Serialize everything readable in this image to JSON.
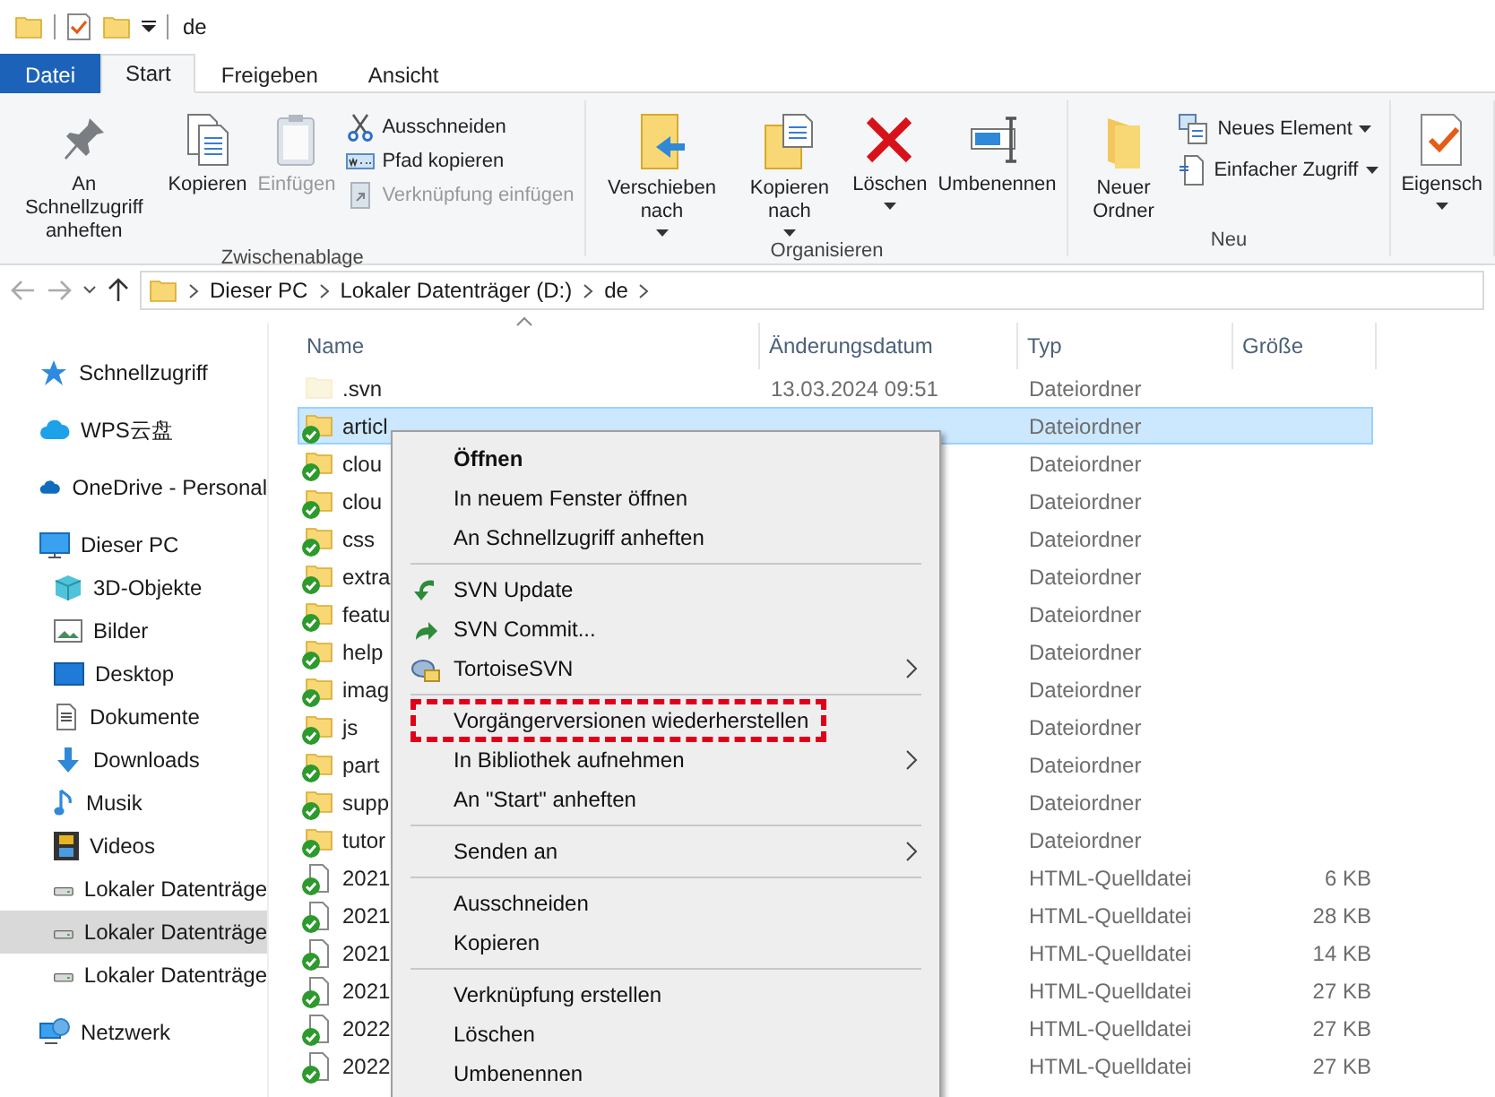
{
  "title_bar": {
    "title": "de"
  },
  "ribbon_tabs": [
    {
      "label": "Datei",
      "kind": "file",
      "selected": false
    },
    {
      "label": "Start",
      "kind": "tab",
      "selected": true
    },
    {
      "label": "Freigeben",
      "kind": "tab",
      "selected": false
    },
    {
      "label": "Ansicht",
      "kind": "tab",
      "selected": false
    }
  ],
  "ribbon_groups": [
    {
      "label": "Zwischenablage",
      "large": [
        {
          "label": "An Schnellzugriff anheften",
          "disabled": false,
          "dropdown": false
        },
        {
          "label": "Kopieren",
          "disabled": false,
          "dropdown": false
        },
        {
          "label": "Einfügen",
          "disabled": true,
          "dropdown": false
        }
      ],
      "small": [
        {
          "label": "Ausschneiden",
          "disabled": false,
          "dropdown": false
        },
        {
          "label": "Pfad kopieren",
          "disabled": false,
          "dropdown": false
        },
        {
          "label": "Verknüpfung einfügen",
          "disabled": true,
          "dropdown": false
        }
      ]
    },
    {
      "label": "Organisieren",
      "large": [
        {
          "label": "Verschieben nach",
          "disabled": false,
          "dropdown": true
        },
        {
          "label": "Kopieren nach",
          "disabled": false,
          "dropdown": true
        },
        {
          "label": "Löschen",
          "disabled": false,
          "dropdown": true
        },
        {
          "label": "Umbenennen",
          "disabled": false,
          "dropdown": false
        }
      ]
    },
    {
      "label": "Neu",
      "large": [
        {
          "label": "Neuer Ordner",
          "disabled": false,
          "dropdown": false
        }
      ],
      "small": [
        {
          "label": "Neues Element",
          "disabled": false,
          "dropdown": true
        },
        {
          "label": "Einfacher Zugriff",
          "disabled": false,
          "dropdown": true
        }
      ]
    },
    {
      "large": [
        {
          "label": "Eigensch",
          "disabled": false,
          "dropdown": true
        }
      ]
    }
  ],
  "breadcrumb": [
    "Dieser PC",
    "Lokaler Datenträger (D:)",
    "de"
  ],
  "sidebar": {
    "items": [
      {
        "label": "Schnellzugriff",
        "selected": false
      },
      {
        "label": "WPS云盘",
        "selected": false
      },
      {
        "label": "OneDrive - Personal",
        "selected": false
      },
      {
        "label": "Dieser PC",
        "selected": false,
        "children": [
          {
            "label": "3D-Objekte",
            "selected": false
          },
          {
            "label": "Bilder",
            "selected": false
          },
          {
            "label": "Desktop",
            "selected": false
          },
          {
            "label": "Dokumente",
            "selected": false
          },
          {
            "label": "Downloads",
            "selected": false
          },
          {
            "label": "Musik",
            "selected": false
          },
          {
            "label": "Videos",
            "selected": false
          },
          {
            "label": "Lokaler Datenträge",
            "selected": false
          },
          {
            "label": "Lokaler Datenträge",
            "selected": true
          },
          {
            "label": "Lokaler Datenträge",
            "selected": false
          }
        ]
      },
      {
        "label": "Netzwerk",
        "selected": false
      }
    ]
  },
  "file_list": {
    "columns": [
      "Name",
      "Änderungsdatum",
      "Typ",
      "Größe"
    ],
    "rows": [
      {
        "kind": "folder",
        "name": ".svn",
        "date": "13.03.2024 09:51",
        "type": "Dateiordner",
        "size": "",
        "hidden": true,
        "versioned": false,
        "selected": false
      },
      {
        "kind": "folder",
        "name": "articl",
        "date": "",
        "type": "Dateiordner",
        "size": "",
        "hidden": false,
        "versioned": true,
        "selected": true
      },
      {
        "kind": "folder",
        "name": "clou",
        "date": "",
        "type": "Dateiordner",
        "size": "",
        "hidden": false,
        "versioned": true,
        "selected": false
      },
      {
        "kind": "folder",
        "name": "clou",
        "date": "",
        "type": "Dateiordner",
        "size": "",
        "hidden": false,
        "versioned": true,
        "selected": false
      },
      {
        "kind": "folder",
        "name": "css",
        "date": "",
        "type": "Dateiordner",
        "size": "",
        "hidden": false,
        "versioned": true,
        "selected": false
      },
      {
        "kind": "folder",
        "name": "extra",
        "date": "",
        "type": "Dateiordner",
        "size": "",
        "hidden": false,
        "versioned": true,
        "selected": false
      },
      {
        "kind": "folder",
        "name": "featu",
        "date": "",
        "type": "Dateiordner",
        "size": "",
        "hidden": false,
        "versioned": true,
        "selected": false
      },
      {
        "kind": "folder",
        "name": "help",
        "date": "",
        "type": "Dateiordner",
        "size": "",
        "hidden": false,
        "versioned": true,
        "selected": false
      },
      {
        "kind": "folder",
        "name": "imag",
        "date": "",
        "type": "Dateiordner",
        "size": "",
        "hidden": false,
        "versioned": true,
        "selected": false
      },
      {
        "kind": "folder",
        "name": "js",
        "date": "",
        "type": "Dateiordner",
        "size": "",
        "hidden": false,
        "versioned": true,
        "selected": false
      },
      {
        "kind": "folder",
        "name": "part",
        "date": "",
        "type": "Dateiordner",
        "size": "",
        "hidden": false,
        "versioned": true,
        "selected": false
      },
      {
        "kind": "folder",
        "name": "supp",
        "date": "",
        "type": "Dateiordner",
        "size": "",
        "hidden": false,
        "versioned": true,
        "selected": false
      },
      {
        "kind": "folder",
        "name": "tutor",
        "date": "",
        "type": "Dateiordner",
        "size": "",
        "hidden": false,
        "versioned": true,
        "selected": false
      },
      {
        "kind": "file",
        "name": "2021",
        "date": "",
        "type": "HTML-Quelldatei",
        "size": "6 KB",
        "hidden": false,
        "versioned": true,
        "selected": false
      },
      {
        "kind": "file",
        "name": "2021",
        "date": "",
        "type": "HTML-Quelldatei",
        "size": "28 KB",
        "hidden": false,
        "versioned": true,
        "selected": false
      },
      {
        "kind": "file",
        "name": "2021",
        "date": "",
        "type": "HTML-Quelldatei",
        "size": "14 KB",
        "hidden": false,
        "versioned": true,
        "selected": false
      },
      {
        "kind": "file",
        "name": "2021",
        "date": "",
        "type": "HTML-Quelldatei",
        "size": "27 KB",
        "hidden": false,
        "versioned": true,
        "selected": false
      },
      {
        "kind": "file",
        "name": "2022",
        "date": "",
        "type": "HTML-Quelldatei",
        "size": "27 KB",
        "hidden": false,
        "versioned": true,
        "selected": false
      },
      {
        "kind": "file",
        "name": "2022",
        "date": "",
        "type": "HTML-Quelldatei",
        "size": "27 KB",
        "hidden": false,
        "versioned": true,
        "selected": false
      }
    ]
  },
  "context_menu": {
    "items": [
      {
        "kind": "item",
        "label": "Öffnen",
        "bold": true,
        "submenu": false,
        "marked": false
      },
      {
        "kind": "item",
        "label": "In neuem Fenster öffnen",
        "bold": false,
        "submenu": false,
        "marked": false
      },
      {
        "kind": "item",
        "label": "An Schnellzugriff anheften",
        "bold": false,
        "submenu": false,
        "marked": false
      },
      {
        "kind": "separator"
      },
      {
        "kind": "item",
        "label": "SVN Update",
        "bold": false,
        "submenu": false,
        "marked": false
      },
      {
        "kind": "item",
        "label": "SVN Commit...",
        "bold": false,
        "submenu": false,
        "marked": false
      },
      {
        "kind": "item",
        "label": "TortoiseSVN",
        "bold": false,
        "submenu": true,
        "marked": false
      },
      {
        "kind": "separator"
      },
      {
        "kind": "item",
        "label": "Vorgängerversionen wiederherstellen",
        "bold": false,
        "submenu": false,
        "marked": true
      },
      {
        "kind": "item",
        "label": "In Bibliothek aufnehmen",
        "bold": false,
        "submenu": true,
        "marked": false
      },
      {
        "kind": "item",
        "label": "An \"Start\" anheften",
        "bold": false,
        "submenu": false,
        "marked": false
      },
      {
        "kind": "separator"
      },
      {
        "kind": "item",
        "label": "Senden an",
        "bold": false,
        "submenu": true,
        "marked": false
      },
      {
        "kind": "separator"
      },
      {
        "kind": "item",
        "label": "Ausschneiden",
        "bold": false,
        "submenu": false,
        "marked": false
      },
      {
        "kind": "item",
        "label": "Kopieren",
        "bold": false,
        "submenu": false,
        "marked": false
      },
      {
        "kind": "separator"
      },
      {
        "kind": "item",
        "label": "Verknüpfung erstellen",
        "bold": false,
        "submenu": false,
        "marked": false
      },
      {
        "kind": "item",
        "label": "Löschen",
        "bold": false,
        "submenu": false,
        "marked": false
      },
      {
        "kind": "item",
        "label": "Umbenennen",
        "bold": false,
        "submenu": false,
        "marked": false
      }
    ]
  }
}
